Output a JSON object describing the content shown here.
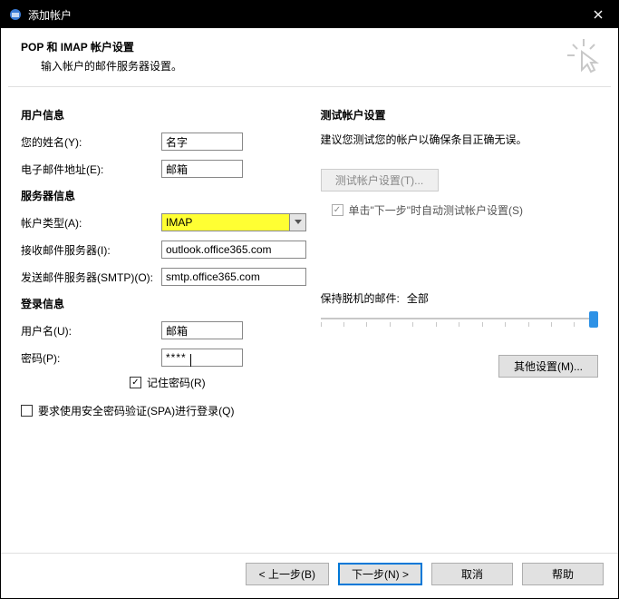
{
  "titlebar": {
    "title": "添加帐户"
  },
  "header": {
    "h1": "POP 和 IMAP 帐户设置",
    "h2": "输入帐户的邮件服务器设置。"
  },
  "left": {
    "userinfo_title": "用户信息",
    "name_label": "您的姓名(Y):",
    "name_value": "名字",
    "email_label": "电子邮件地址(E):",
    "email_value": "邮箱",
    "serverinfo_title": "服务器信息",
    "account_type_label": "帐户类型(A):",
    "account_type_value": "IMAP",
    "incoming_label": "接收邮件服务器(I):",
    "incoming_value": "outlook.office365.com",
    "outgoing_label": "发送邮件服务器(SMTP)(O):",
    "outgoing_value": "smtp.office365.com",
    "login_title": "登录信息",
    "username_label": "用户名(U):",
    "username_value": "邮箱",
    "password_label": "密码(P):",
    "password_value": "****",
    "remember_label": "记住密码(R)",
    "spa_label": "要求使用安全密码验证(SPA)进行登录(Q)"
  },
  "right": {
    "test_title": "测试帐户设置",
    "test_note": "建议您测试您的帐户以确保条目正确无误。",
    "test_button": "测试帐户设置(T)...",
    "auto_test_label": "单击\"下一步\"时自动测试帐户设置(S)",
    "offline_label": "保持脱机的邮件:",
    "offline_value": "全部",
    "more_button": "其他设置(M)..."
  },
  "footer": {
    "back": "< 上一步(B)",
    "next": "下一步(N) >",
    "cancel": "取消",
    "help": "帮助"
  }
}
